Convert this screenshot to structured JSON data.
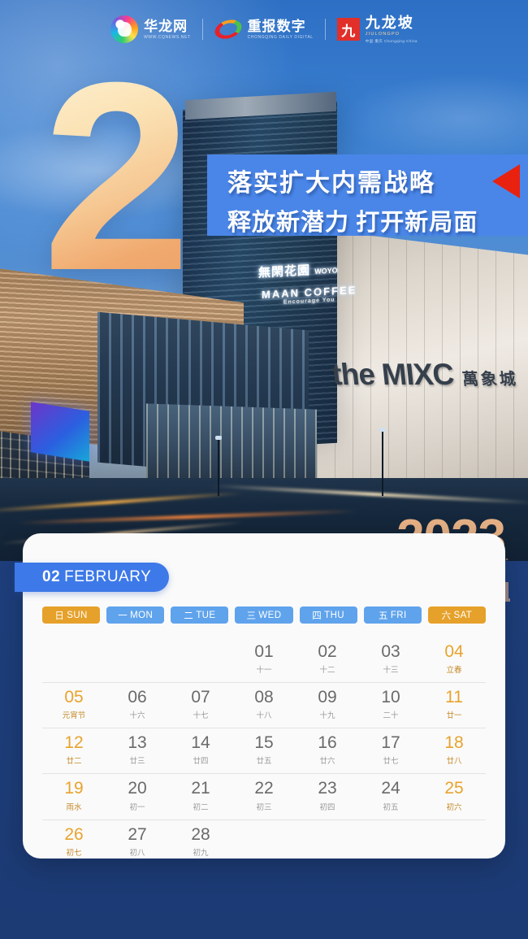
{
  "poster": {
    "background_color": "#1e3f7f",
    "accent_blue": "#4a86e8",
    "accent_orange": "#e8a32c",
    "year": "2023",
    "big_month_numeral": "2"
  },
  "logos": [
    {
      "name": "华龙网",
      "cn": "华龙网",
      "en": "WWW.CQNEWS.NET"
    },
    {
      "name": "重报数字",
      "cn": "重报数字",
      "en": "CHONGQING DAILY DIGITAL"
    },
    {
      "name": "九龙坡",
      "cn": "九龙坡",
      "en": "JIULONGPO",
      "en2": "中国·重庆 Chongqing·China",
      "mark": "九"
    }
  ],
  "headline": {
    "line1": "落实扩大内需战略",
    "line2": "释放新潜力  打开新局面",
    "arrow_color": "#e8220f"
  },
  "photo": {
    "signs": [
      {
        "text": "無閑花園",
        "sub": "WOYO"
      },
      {
        "text": "MAAN COFFEE",
        "sub": "Encourage You"
      },
      {
        "text": "the MIXC",
        "cn": "萬象城"
      }
    ]
  },
  "calendar": {
    "month_number": "02",
    "month_name": "FEBRUARY",
    "weekdays": [
      {
        "zh": "日",
        "en": "SUN",
        "style": "orange"
      },
      {
        "zh": "一",
        "en": "MON",
        "style": "blue"
      },
      {
        "zh": "二",
        "en": "TUE",
        "style": "blue"
      },
      {
        "zh": "三",
        "en": "WED",
        "style": "blue"
      },
      {
        "zh": "四",
        "en": "THU",
        "style": "blue"
      },
      {
        "zh": "五",
        "en": "FRI",
        "style": "blue"
      },
      {
        "zh": "六",
        "en": "SAT",
        "style": "orange"
      }
    ],
    "weeks": [
      [
        {
          "day": "",
          "lunar": "",
          "highlight": false
        },
        {
          "day": "",
          "lunar": "",
          "highlight": false
        },
        {
          "day": "",
          "lunar": "",
          "highlight": false
        },
        {
          "day": "01",
          "lunar": "十一",
          "highlight": false
        },
        {
          "day": "02",
          "lunar": "十二",
          "highlight": false
        },
        {
          "day": "03",
          "lunar": "十三",
          "highlight": false
        },
        {
          "day": "04",
          "lunar": "立春",
          "highlight": true
        }
      ],
      [
        {
          "day": "05",
          "lunar": "元宵节",
          "highlight": true
        },
        {
          "day": "06",
          "lunar": "十六",
          "highlight": false
        },
        {
          "day": "07",
          "lunar": "十七",
          "highlight": false
        },
        {
          "day": "08",
          "lunar": "十八",
          "highlight": false
        },
        {
          "day": "09",
          "lunar": "十九",
          "highlight": false
        },
        {
          "day": "10",
          "lunar": "二十",
          "highlight": false
        },
        {
          "day": "11",
          "lunar": "廿一",
          "highlight": true
        }
      ],
      [
        {
          "day": "12",
          "lunar": "廿二",
          "highlight": true
        },
        {
          "day": "13",
          "lunar": "廿三",
          "highlight": false
        },
        {
          "day": "14",
          "lunar": "廿四",
          "highlight": false
        },
        {
          "day": "15",
          "lunar": "廿五",
          "highlight": false
        },
        {
          "day": "16",
          "lunar": "廿六",
          "highlight": false
        },
        {
          "day": "17",
          "lunar": "廿七",
          "highlight": false
        },
        {
          "day": "18",
          "lunar": "廿八",
          "highlight": true
        }
      ],
      [
        {
          "day": "19",
          "lunar": "雨水",
          "highlight": true
        },
        {
          "day": "20",
          "lunar": "初一",
          "highlight": false
        },
        {
          "day": "21",
          "lunar": "初二",
          "highlight": false
        },
        {
          "day": "22",
          "lunar": "初三",
          "highlight": false
        },
        {
          "day": "23",
          "lunar": "初四",
          "highlight": false
        },
        {
          "day": "24",
          "lunar": "初五",
          "highlight": false
        },
        {
          "day": "25",
          "lunar": "初六",
          "highlight": true
        }
      ],
      [
        {
          "day": "26",
          "lunar": "初七",
          "highlight": true
        },
        {
          "day": "27",
          "lunar": "初八",
          "highlight": false
        },
        {
          "day": "28",
          "lunar": "初九",
          "highlight": false
        },
        {
          "day": "",
          "lunar": "",
          "highlight": false
        },
        {
          "day": "",
          "lunar": "",
          "highlight": false
        },
        {
          "day": "",
          "lunar": "",
          "highlight": false
        },
        {
          "day": "",
          "lunar": "",
          "highlight": false
        }
      ]
    ]
  }
}
